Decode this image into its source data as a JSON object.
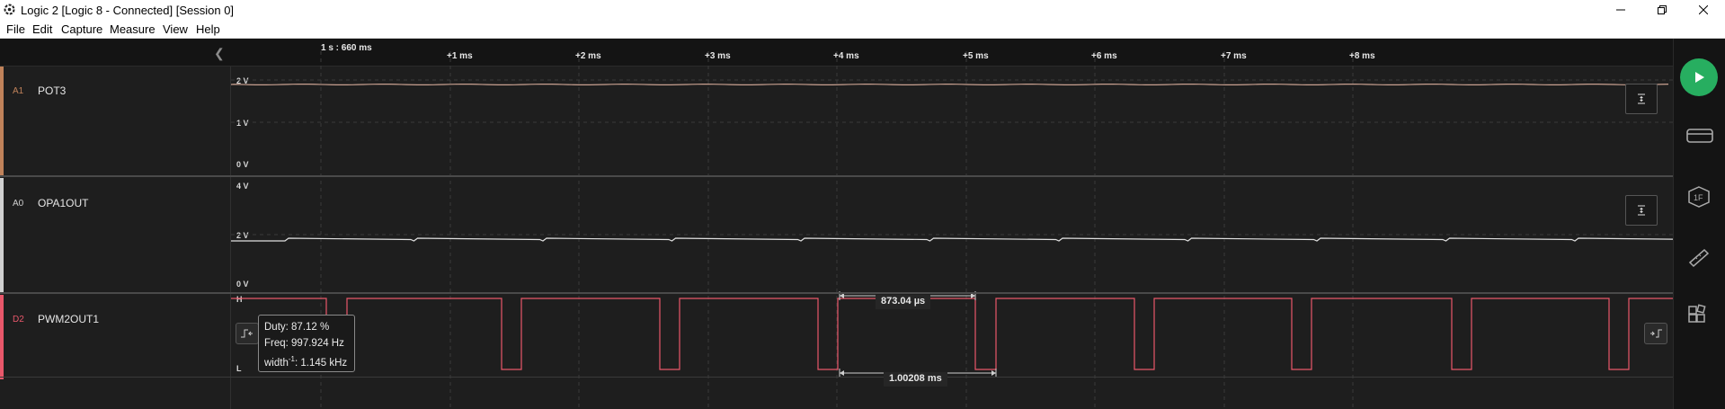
{
  "window": {
    "title": "Logic 2 [Logic 8 - Connected] [Session 0]",
    "controls": [
      "minimize-icon",
      "restore-icon",
      "close-icon"
    ]
  },
  "menu": [
    "File",
    "Edit",
    "Capture",
    "Measure",
    "View",
    "Help"
  ],
  "ruler": {
    "origin_label": "1 s : 660 ms",
    "ticks": [
      "+1 ms",
      "+2 ms",
      "+3 ms",
      "+4 ms",
      "+5 ms",
      "+6 ms",
      "+7 ms",
      "+8 ms"
    ]
  },
  "channels": [
    {
      "id": "A1",
      "name": "POT3",
      "color": "#c0825a",
      "y_labels": [
        "2 V",
        "1 V",
        "0 V"
      ]
    },
    {
      "id": "A0",
      "name": "OPA1OUT",
      "color": "#d0d0d0",
      "y_labels": [
        "4 V",
        "2 V",
        "0 V"
      ]
    },
    {
      "id": "D2",
      "name": "PWM2OUT1",
      "color": "#e8576a",
      "y_labels": [
        "H",
        "L"
      ]
    }
  ],
  "measurement": {
    "duty": "Duty: 87.12 %",
    "freq": "Freq: 997.924 Hz",
    "width_prefix": "width",
    "width_sup": "-1",
    "width_value": ": 1.145 kHz",
    "pulse_width": "873.04 µs",
    "period": "1.00208 ms"
  },
  "colors": {
    "analog_trace": "#e0e0e0",
    "pot_trace": "#c8a090",
    "digital_trace": "#e8576a",
    "play_button": "#27ae60",
    "background": "#1e1e1e"
  },
  "sidebar_icons": [
    "play-icon",
    "analyzers-icon",
    "extensions-icon",
    "measure-ruler-icon",
    "layout-icon"
  ]
}
